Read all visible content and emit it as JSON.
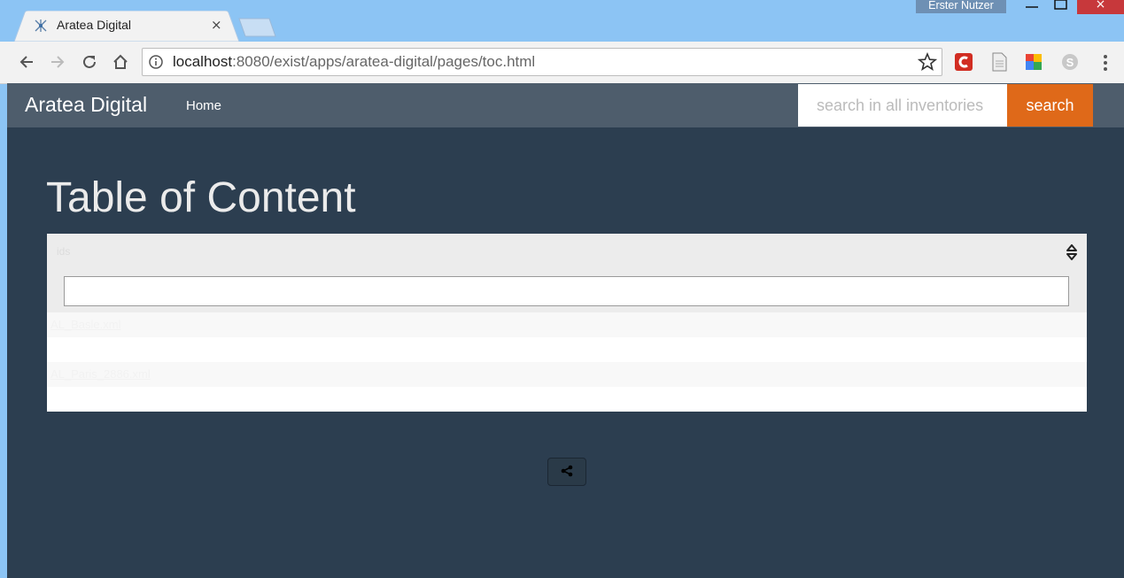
{
  "browser": {
    "tab_title": "Aratea Digital",
    "tab_close": "×",
    "user": "Erster Nutzer",
    "url_host": "localhost",
    "url_rest": ":8080/exist/apps/aratea-digital/pages/toc.html",
    "win_close": "×"
  },
  "navbar": {
    "brand": "Aratea Digital",
    "home": "Home",
    "search_placeholder": "search in all inventories",
    "search_label": "search"
  },
  "main": {
    "heading": "Table of Content",
    "sort_header": "ids",
    "rows": [
      "AL_Basle.xml",
      "",
      "AL_Paris_2886.xml",
      ""
    ]
  },
  "colors": {
    "accent": "#df6919",
    "navbar": "#4e5d6c",
    "background": "#2c3e50"
  }
}
